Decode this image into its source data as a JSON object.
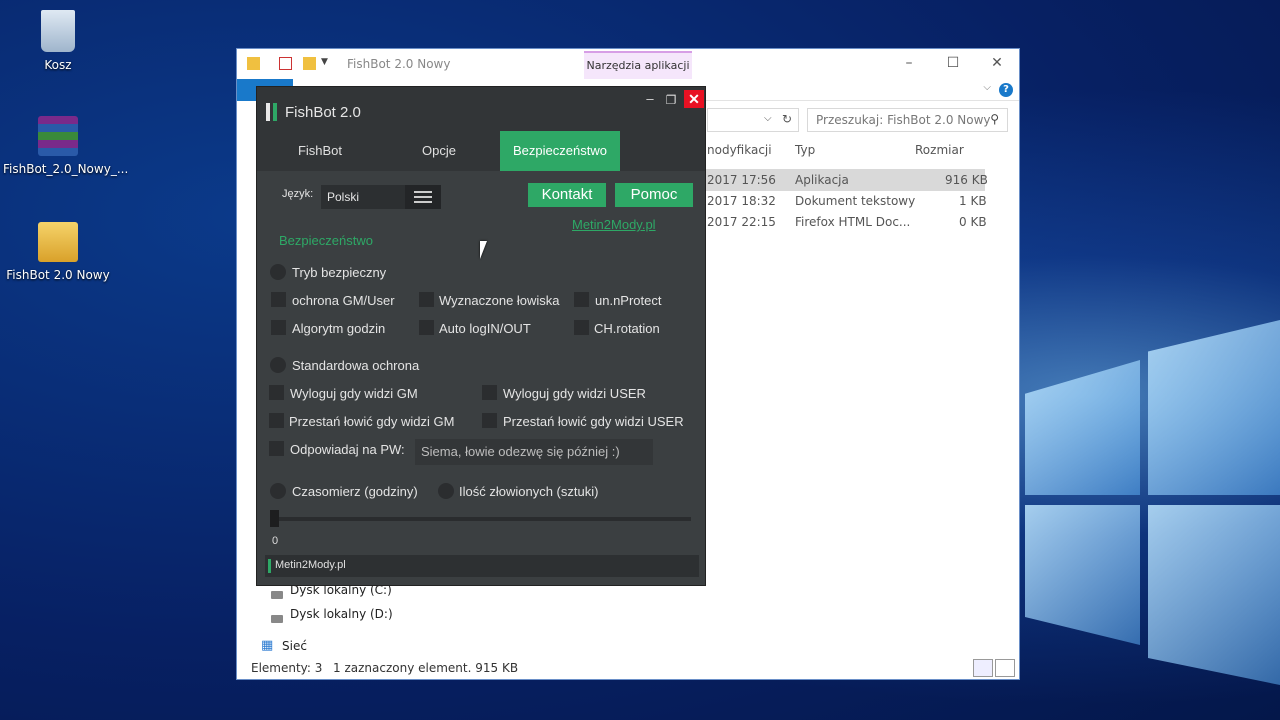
{
  "desktop": {
    "icons": [
      {
        "label": "Kosz"
      },
      {
        "label": "FishBot_2.0_Nowy_..."
      },
      {
        "label": "FishBot 2.0 Nowy"
      }
    ]
  },
  "explorer": {
    "title": "FishBot 2.0 Nowy",
    "tools_tab": "Narzędzia aplikacji",
    "search_placeholder": "Przeszukaj: FishBot 2.0 Nowy",
    "columns": [
      "nodyfikacji",
      "Typ",
      "Rozmiar"
    ],
    "rows": [
      {
        "date": "2017 17:56",
        "type": "Aplikacja",
        "size": "916 KB"
      },
      {
        "date": "2017 18:32",
        "type": "Dokument tekstowy",
        "size": "1 KB"
      },
      {
        "date": "2017 22:15",
        "type": "Firefox HTML Doc...",
        "size": "0 KB"
      }
    ],
    "nav": [
      "Dysk lokalny (C:)",
      "Dysk lokalny (D:)",
      "Sieć"
    ],
    "status_count": "Elementy: 3",
    "status_selected": "1 zaznaczony element. 915 KB"
  },
  "fishbot": {
    "title": "FishBot 2.0",
    "tabs": [
      "FishBot",
      "Opcje",
      "Bezpieczeństwo"
    ],
    "language_label": "Język:",
    "language_value": "Polski",
    "contact_btn": "Kontakt",
    "help_btn": "Pomoc",
    "site_link": "Metin2Mody.pl",
    "section_title": "Bezpieczeństwo",
    "safe_mode": "Tryb bezpieczny",
    "opt_gm_user": "ochrona GM/User",
    "opt_spots": "Wyznaczone łowiska",
    "opt_unprotect": "un.nProtect",
    "opt_algorithm": "Algorytm godzin",
    "opt_autologin": "Auto logIN/OUT",
    "opt_chrotation": "CH.rotation",
    "standard_protection": "Standardowa ochrona",
    "logout_gm": "Wyloguj gdy widzi GM",
    "logout_user": "Wyloguj gdy widzi USER",
    "stop_gm": "Przestań łowić gdy widzi GM",
    "stop_user": "Przestań łowić gdy widzi USER",
    "reply_pw": "Odpowiadaj na PW:",
    "reply_text": "Siema, łowie odezwę się później :)",
    "timer_hours": "Czasomierz (godziny)",
    "caught_count": "Ilość złowionych (sztuki)",
    "slider_value": "0",
    "status": "Metin2Mody.pl"
  }
}
